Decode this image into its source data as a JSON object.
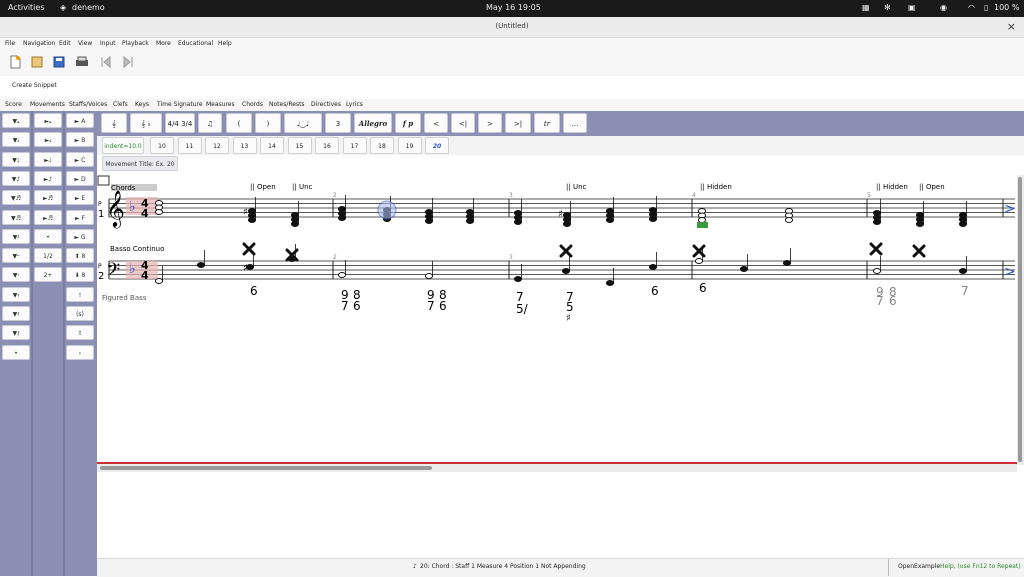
{
  "system": {
    "activities": "Activities",
    "app": "denemo",
    "clock": "May 16  19:05",
    "battery": "100 %"
  },
  "window": {
    "title": "(Untitled)",
    "close": "×"
  },
  "menu": [
    "File",
    "Navigation",
    "Edit",
    "View",
    "Input",
    "Playback",
    "More",
    "Educational",
    "Help"
  ],
  "toolbar": {
    "create_snippet": "Create Snippet"
  },
  "submenu": [
    "Score",
    "Movements",
    "Staffs/Voices",
    "Clefs",
    "Keys",
    "Time Signature",
    "Measures",
    "Chords",
    "Notes/Rests",
    "Directives",
    "Lyrics"
  ],
  "palette_left": {
    "col1": [
      "▼𝅝",
      "▼𝅗𝅥",
      "▼♩",
      "▼♪",
      "▼♬",
      "▼♬",
      "▼𝄽",
      "▼𝄼",
      "▼𝄾",
      "▼𝄿",
      "▼𝅀",
      "▼𝅁",
      "•"
    ],
    "col2": [
      "►𝅝",
      "►𝅗𝅥",
      "►♩",
      "►♪",
      "►♬",
      "►♬",
      "•",
      "1/2",
      "2+"
    ],
    "col3": [
      "► A",
      "► B",
      "► C",
      "► D",
      "► E",
      "► F",
      "► G",
      "⬆ 8",
      "⬇ 8",
      "!",
      "(s)",
      "⇧",
      "›"
    ]
  },
  "palette_top": [
    "𝄞",
    "𝄞 ♭",
    "4/4 3/4",
    "",
    "(",
    ")",
    "",
    "3",
    "Allegro",
    "f p",
    "<",
    "<|",
    ">",
    ">|",
    "tr",
    "…"
  ],
  "palette_row2": {
    "indent": "indent=10.0",
    "numbers": [
      "10",
      "11",
      "12",
      "13",
      "14",
      "15",
      "16",
      "17",
      "18",
      "19",
      "20"
    ]
  },
  "movement_title": "Movement Title: Ex. 20",
  "score": {
    "staff1_name": "Chords",
    "staff2_name": "Basso Continuo",
    "figured_label": "Figured Bass",
    "staff1_number": "1",
    "staff2_number": "2",
    "time_sig": "4",
    "measure_numbers": [
      "2",
      "3",
      "4",
      "5"
    ],
    "directives": [
      "|| Open",
      "|| Unc",
      "|| Unc",
      "|| Hidden",
      "|| Hidden",
      "|| Open"
    ],
    "figures": [
      "6",
      "9",
      "8",
      "7",
      "6",
      "9",
      "8",
      "7",
      "6",
      "7",
      "5/",
      "7",
      "5",
      "♯",
      "6",
      "6",
      "9",
      "8",
      "7",
      "6",
      "7"
    ]
  },
  "status": {
    "left": "20: Chord : Staff 1 Measure 4 Position 1 Not Appending",
    "right_label": "OpenExample",
    "right_help": "Help, (use Fn12 to Repeat)"
  },
  "colors": {
    "accent": "#8b8fb3",
    "selection": "#3355cc",
    "red": "#cc3030"
  }
}
